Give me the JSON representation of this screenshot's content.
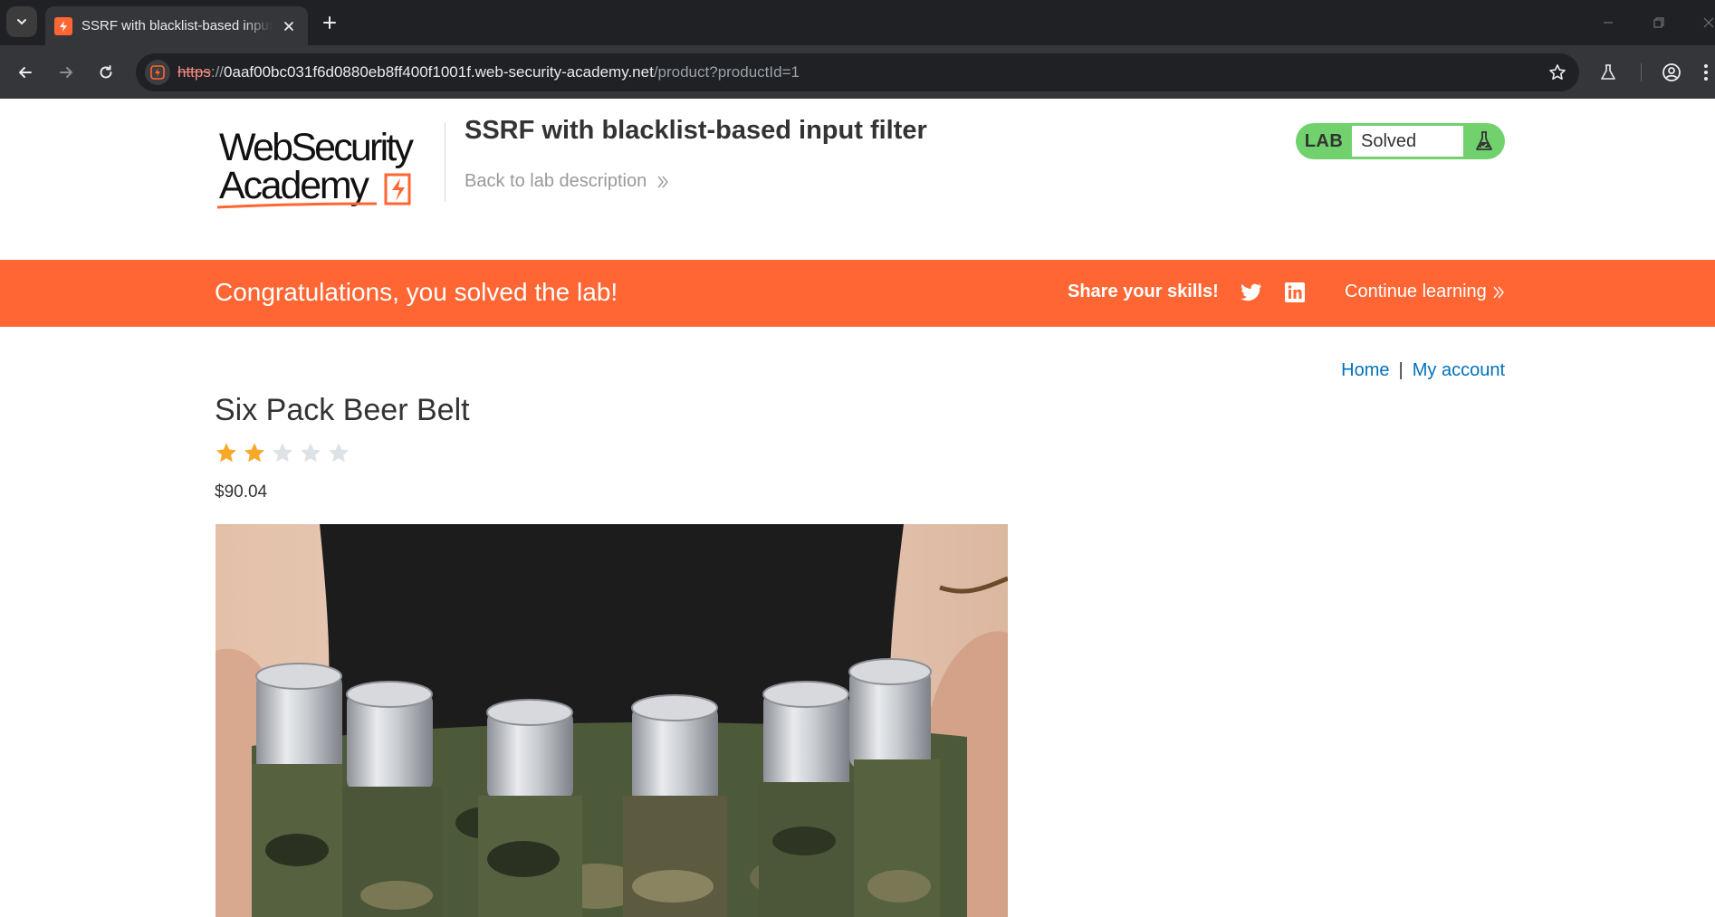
{
  "browser": {
    "tab_title": "SSRF with blacklist-based input filter",
    "url": {
      "scheme": "https",
      "rest": "://",
      "host": "0aaf00bc031f6d0880eb8ff400f1001f.web-security-academy.net",
      "path": "/product?productId=1"
    }
  },
  "lab": {
    "logo_line1": "WebSecurity",
    "logo_line2": "Academy",
    "title": "SSRF with blacklist-based input filter",
    "back_link": "Back to lab description",
    "status_tag": "LAB",
    "status": "Solved"
  },
  "banner": {
    "message": "Congratulations, you solved the lab!",
    "share": "Share your skills!",
    "continue": "Continue learning"
  },
  "nav": {
    "home": "Home",
    "separator": "|",
    "account": "My account"
  },
  "product": {
    "name": "Six Pack Beer Belt",
    "rating": 2,
    "rating_max": 5,
    "price": "$90.04"
  },
  "colors": {
    "brand_orange": "#ff6633",
    "lab_green": "#70d16d",
    "link_blue": "#0071bc",
    "star_filled": "#f7a829",
    "star_empty": "#dde2e6"
  },
  "icons": {
    "tab_dropdown": "chevron-down-icon",
    "tab_close": "close-icon",
    "new_tab": "plus-icon",
    "back": "arrow-left-icon",
    "forward": "arrow-right-icon",
    "reload": "reload-icon",
    "bookmark": "star-outline-icon",
    "labs": "flask-icon",
    "profile": "profile-icon",
    "menu": "kebab-menu-icon",
    "twitter": "twitter-icon",
    "linkedin": "linkedin-icon"
  }
}
